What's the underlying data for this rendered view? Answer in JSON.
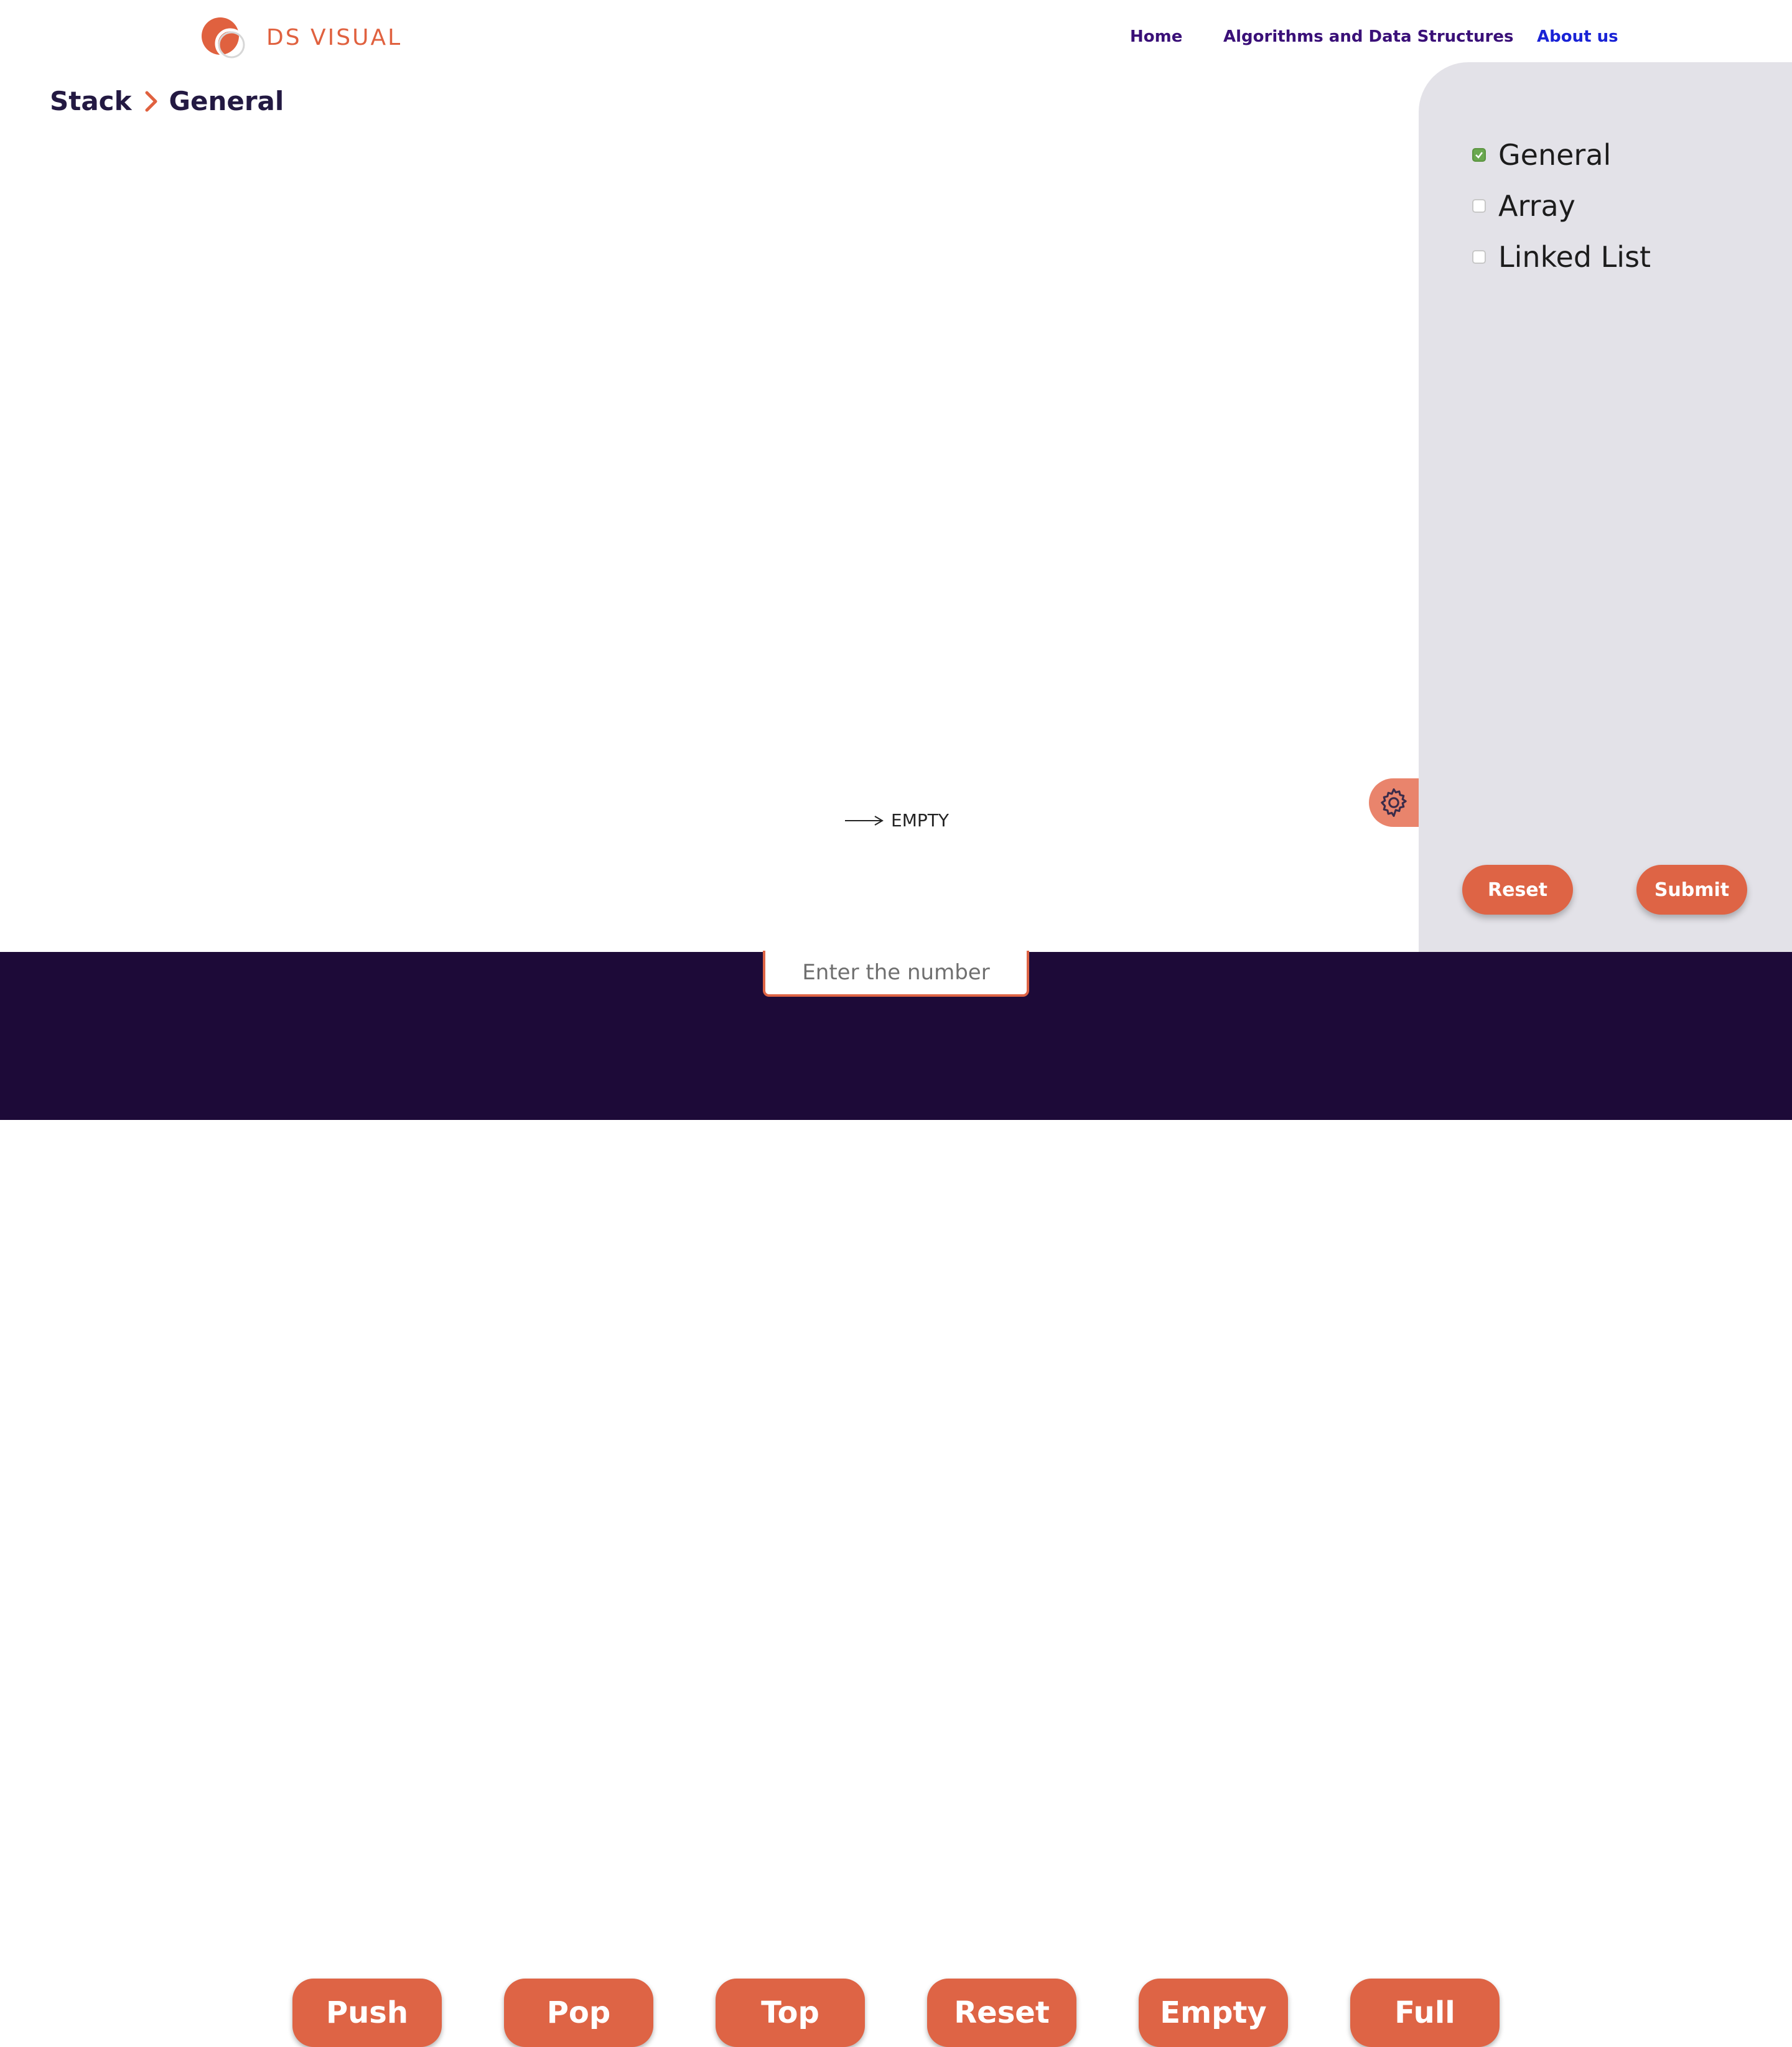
{
  "header": {
    "brand": "DS VISUAL",
    "nav": {
      "home": "Home",
      "algorithms": "Algorithms and Data Structures",
      "about": "About us"
    }
  },
  "breadcrumb": {
    "parent": "Stack",
    "current": "General"
  },
  "side_panel": {
    "options": [
      {
        "label": "General",
        "checked": true
      },
      {
        "label": "Array",
        "checked": false
      },
      {
        "label": "Linked List",
        "checked": false
      }
    ],
    "reset_label": "Reset",
    "submit_label": "Submit"
  },
  "canvas": {
    "pointer_label": "EMPTY"
  },
  "controls": {
    "input_placeholder": "Enter the number",
    "buttons": [
      "Push",
      "Pop",
      "Top",
      "Reset",
      "Empty",
      "Full"
    ]
  },
  "colors": {
    "accent": "#de6445",
    "nav_text": "#3a1078",
    "nav_active": "#1a23d6",
    "footer_bg": "#1d0a38",
    "panel_bg": "#e3e2e8",
    "check_green": "#6aa84f"
  },
  "icons": [
    "logo-icon",
    "chevron-right-icon",
    "gear-icon",
    "arrow-right-icon",
    "check-icon"
  ]
}
